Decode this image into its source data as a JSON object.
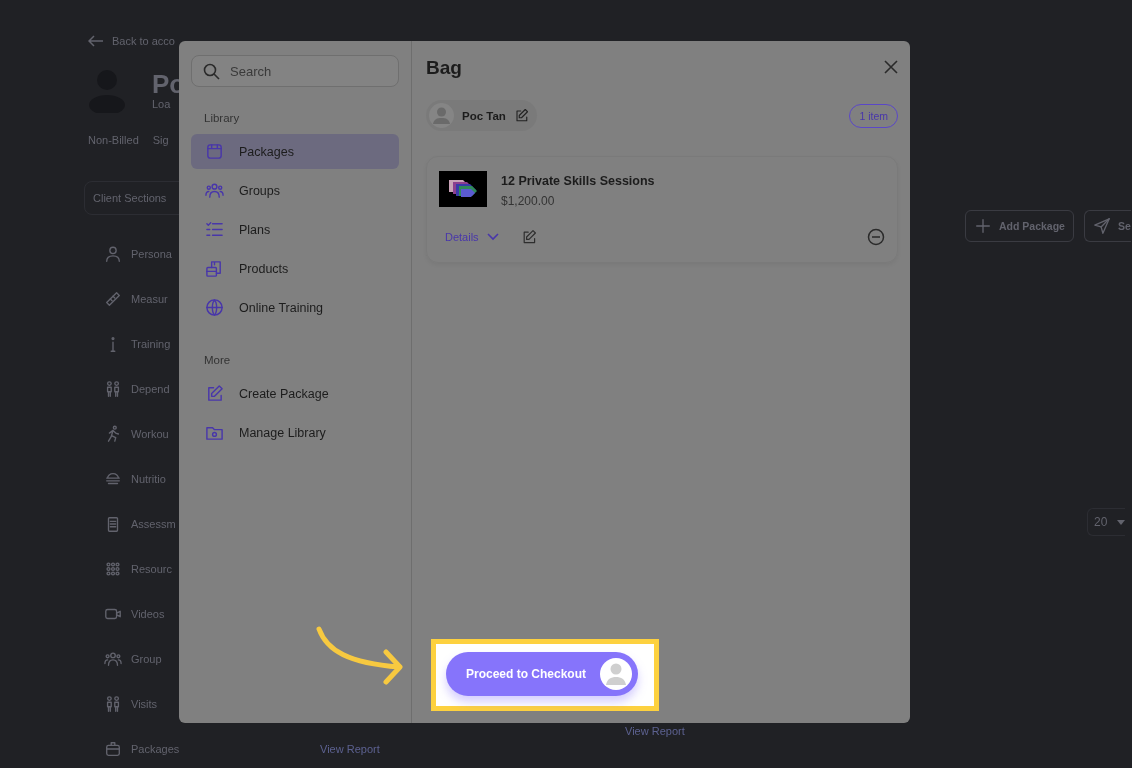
{
  "background_page": {
    "back_link": "Back to acco",
    "client_name": "Po",
    "client_subtitle": "Loa",
    "tags": [
      "Non-Billed",
      "Sig"
    ],
    "section_header": "Client Sections",
    "nav": [
      {
        "label": "Persona",
        "kind": "person"
      },
      {
        "label": "Measur",
        "kind": "ruler"
      },
      {
        "label": "Training",
        "kind": "info"
      },
      {
        "label": "Depend",
        "kind": "dependents"
      },
      {
        "label": "Workou",
        "kind": "runner"
      },
      {
        "label": "Nutritio",
        "kind": "bowl"
      },
      {
        "label": "Assessm",
        "kind": "clipboard"
      },
      {
        "label": "Resourc",
        "kind": "grid"
      },
      {
        "label": "Videos",
        "kind": "video"
      },
      {
        "label": "Group",
        "kind": "group"
      },
      {
        "label": "Visits",
        "kind": "dependents"
      },
      {
        "label": "Packages",
        "kind": "box"
      }
    ],
    "actions": [
      {
        "label": "Add Package",
        "kind": "plus"
      },
      {
        "label": "Se",
        "kind": "send"
      }
    ],
    "page_size": "20",
    "report_links": [
      "View Report",
      "View Report"
    ]
  },
  "modal": {
    "search": {
      "placeholder": "Search"
    },
    "sections": [
      {
        "title": "Library",
        "items": [
          {
            "label": "Packages",
            "kind": "package",
            "selected": true
          },
          {
            "label": "Groups",
            "kind": "group",
            "selected": false
          },
          {
            "label": "Plans",
            "kind": "plans",
            "selected": false
          },
          {
            "label": "Products",
            "kind": "products",
            "selected": false
          },
          {
            "label": "Online Training",
            "kind": "globe",
            "selected": false
          }
        ]
      },
      {
        "title": "More",
        "items": [
          {
            "label": "Create Package",
            "kind": "edit",
            "selected": false
          },
          {
            "label": "Manage Library",
            "kind": "folder",
            "selected": false
          }
        ]
      }
    ],
    "bag": {
      "title": "Bag",
      "client": "Poc Tan",
      "count": "1 item",
      "items": [
        {
          "name": "12 Private Skills Sessions",
          "price": "$1,200.00",
          "details": "Details"
        }
      ]
    },
    "checkout": "Proceed to Checkout"
  }
}
